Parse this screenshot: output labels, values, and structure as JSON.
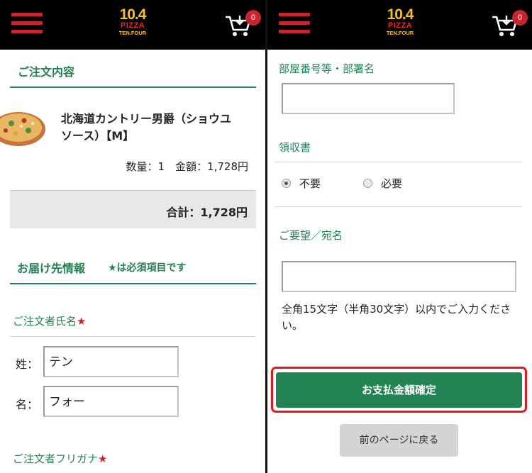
{
  "header": {
    "logo_line1": "10.4",
    "logo_line2": "PIZZA",
    "logo_line3": "TEN.FOUR",
    "cart_count": "0"
  },
  "left": {
    "order_section_title": "ご注文内容",
    "item": {
      "name": "北海道カントリー男爵（ショウユソース）【M】",
      "quantity_amount": "数量：1　金額：1,728円"
    },
    "total": "合計：1,728円",
    "delivery_section_title": "お届け先情報",
    "required_note": "★は必須項目です",
    "orderer_name_label": "ご注文者氏名",
    "required_star": "★",
    "last_name_label": "姓：",
    "last_name_value": "テン",
    "first_name_label": "名：",
    "first_name_value": "フォー",
    "furigana_label": "ご注文者フリガナ"
  },
  "right": {
    "room_label": "部屋番号等・部署名",
    "room_value": "",
    "receipt_label": "領収書",
    "receipt_options": [
      "不要",
      "必要"
    ],
    "receipt_selected": "不要",
    "request_label": "ご要望／宛名",
    "request_value": "",
    "request_hint": "全角15文字（半角30文字）以内でご入力ください。",
    "confirm_button": "お支払金額確定",
    "back_button": "前のページに戻る"
  },
  "colors": {
    "header_bg": "#000000",
    "accent_green": "#238354",
    "accent_red": "#c9252e",
    "highlight_outline": "#e6141b"
  }
}
